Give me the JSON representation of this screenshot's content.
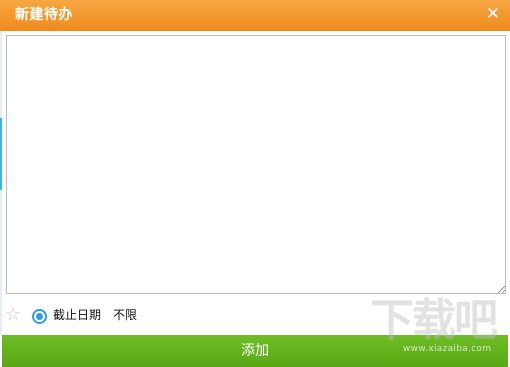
{
  "window": {
    "title": "新建待办",
    "close_symbol": "✕"
  },
  "editor": {
    "value": "",
    "resize_grip_icon": "resize-grip-icon"
  },
  "toolbar": {
    "star_icon": "☆",
    "radio_selected": true,
    "deadline_label": "截止日期",
    "deadline_value": "不限"
  },
  "footer": {
    "add_label": "添加",
    "button_color": "#5daf19"
  },
  "watermark": {
    "logo_text": "下载吧",
    "url": "www.xiazaiba.com"
  },
  "colors": {
    "title_orange_top": "#f7a743",
    "title_orange_bottom": "#ef8a1c",
    "radio_blue": "#2f9fd6",
    "left_accent_cyan": "#3fb6d6"
  }
}
